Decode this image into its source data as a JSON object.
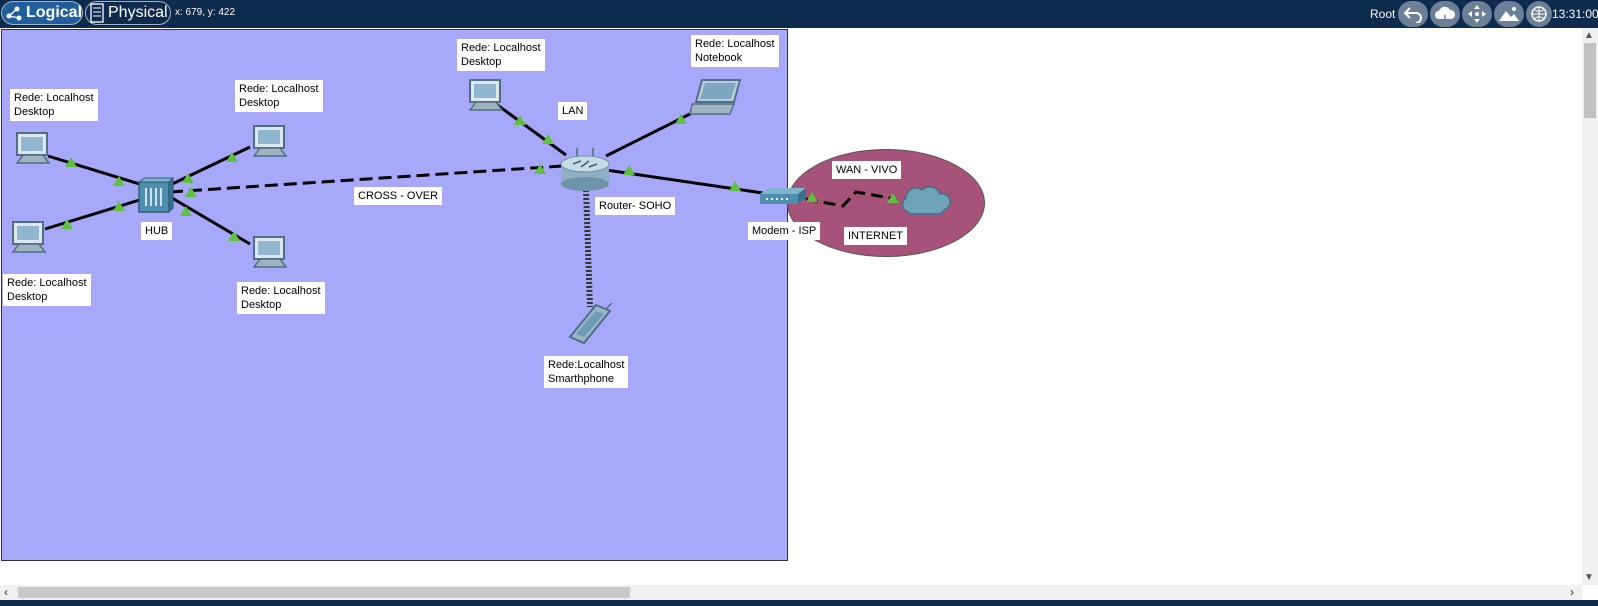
{
  "toolbar": {
    "logical_tab": "Logical",
    "physical_tab": "Physical",
    "coords": "x: 679, y: 422",
    "user": "Root",
    "clock": "13:31:00"
  },
  "labels": {
    "pc1": [
      "Rede: Localhost",
      "Desktop"
    ],
    "pc2": [
      "Rede: Localhost",
      "Desktop"
    ],
    "pc3": [
      "Rede: Localhost",
      "Desktop"
    ],
    "pc4": [
      "Rede: Localhost",
      "Desktop"
    ],
    "pc5": [
      "Rede: Localhost",
      "Desktop"
    ],
    "notebook": [
      "Rede: Localhost",
      "Notebook"
    ],
    "smartphone": [
      "Rede:Localhost",
      "Smarthphone"
    ],
    "hub": "HUB",
    "crossover": "CROSS - OVER",
    "lan": "LAN",
    "router": "Router- SOHO",
    "modem": "Modem - ISP",
    "wan": "WAN - VIVO",
    "internet": "INTERNET"
  },
  "colors": {
    "toolbar_bg": "#0e2a4d",
    "cluster_bg": "#a8a8fb",
    "wan_bg": "#a65279",
    "link_up": "#5fbf3f"
  }
}
